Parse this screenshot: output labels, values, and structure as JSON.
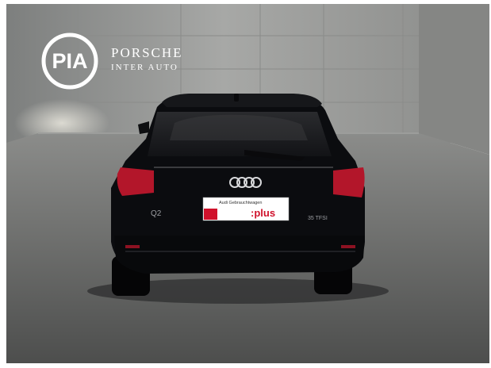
{
  "image": {
    "description_free": true
  },
  "dealer": {
    "logo_monogram": "PIA",
    "brand_name": "PORSCHE",
    "brand_sub": "INTER AUTO"
  },
  "car": {
    "badge_model": "Q2",
    "badge_engine": "35 TFSI",
    "rings_logo": "audi-rings"
  },
  "plate": {
    "line1": "Audi Gebrauchtwagen",
    "line2": ":plus",
    "accent": "#d0112b"
  },
  "colors": {
    "wall": "#8e8f8d",
    "floor": "#6e706e",
    "car_body": "#0b0c0f",
    "taillight": "#b3162a"
  }
}
